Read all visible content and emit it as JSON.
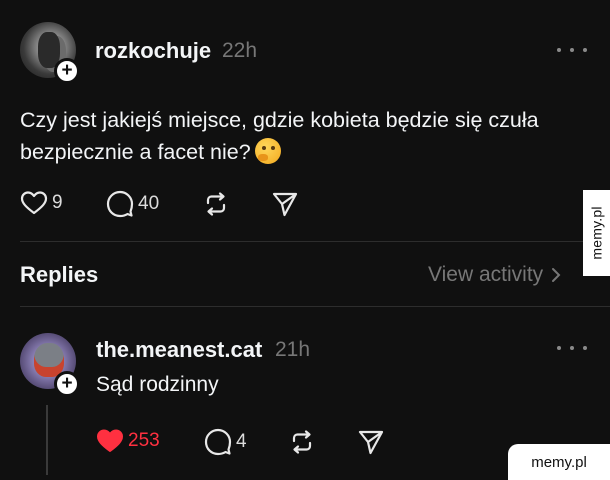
{
  "post": {
    "username": "rozkochuje",
    "time": "22h",
    "text": "Czy jest jakiejś miejsce, gdzie kobieta będzie się czuła bezpiecznie a facet nie?",
    "emoji": "thinking-face",
    "likes": "9",
    "comments": "40"
  },
  "replies_section": {
    "title": "Replies",
    "view_activity": "View activity"
  },
  "reply": {
    "username": "the.meanest.cat",
    "time": "21h",
    "text": "Sąd rodzinny",
    "likes": "253",
    "comments": "4",
    "liked": true,
    "like_color": "#ff3040"
  },
  "watermarks": {
    "side": "memy.pl",
    "corner": "memy.pl"
  },
  "icons": [
    "heart-icon",
    "comment-icon",
    "repost-icon",
    "share-icon",
    "more-icon",
    "follow-plus-icon",
    "chevron-right-icon"
  ]
}
